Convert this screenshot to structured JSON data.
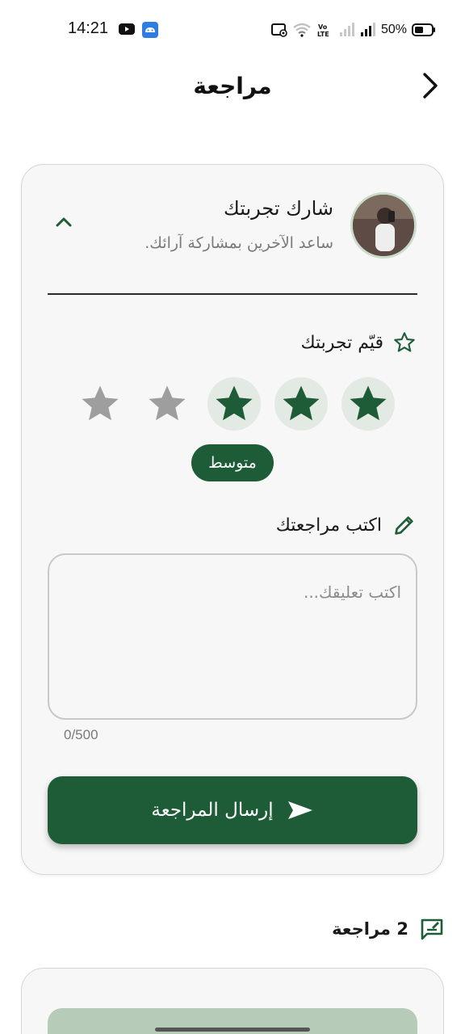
{
  "status_bar": {
    "time": "14:21",
    "battery": "50%",
    "icons": [
      "youtube-icon",
      "android-icon",
      "screen-record-icon",
      "wifi-icon",
      "volte-icon",
      "signal-icon",
      "signal-icon",
      "battery-icon"
    ]
  },
  "header": {
    "title": "مراجعة",
    "back_icon": "chevron-right-icon"
  },
  "review_form": {
    "title": "شارك تجربتك",
    "subtitle": "ساعد الآخرين بمشاركة آرائك.",
    "collapse_icon": "chevron-up-icon",
    "rate_label": "قيّم تجربتك",
    "rating": {
      "value": 3,
      "max": 5
    },
    "rating_label": "متوسط",
    "write_label": "اكتب مراجعتك",
    "comment_placeholder": "اكتب تعليقك...",
    "comment_value": "",
    "char_count": "0/500",
    "submit_label": "إرسال المراجعة"
  },
  "reviews": {
    "count_label": "2 مراجعة"
  },
  "colors": {
    "primary": "#1d5c36",
    "star_filled_bg": "#e3e9e3",
    "star_empty": "#9e9e9e",
    "card_bg": "#f7f7f7"
  }
}
